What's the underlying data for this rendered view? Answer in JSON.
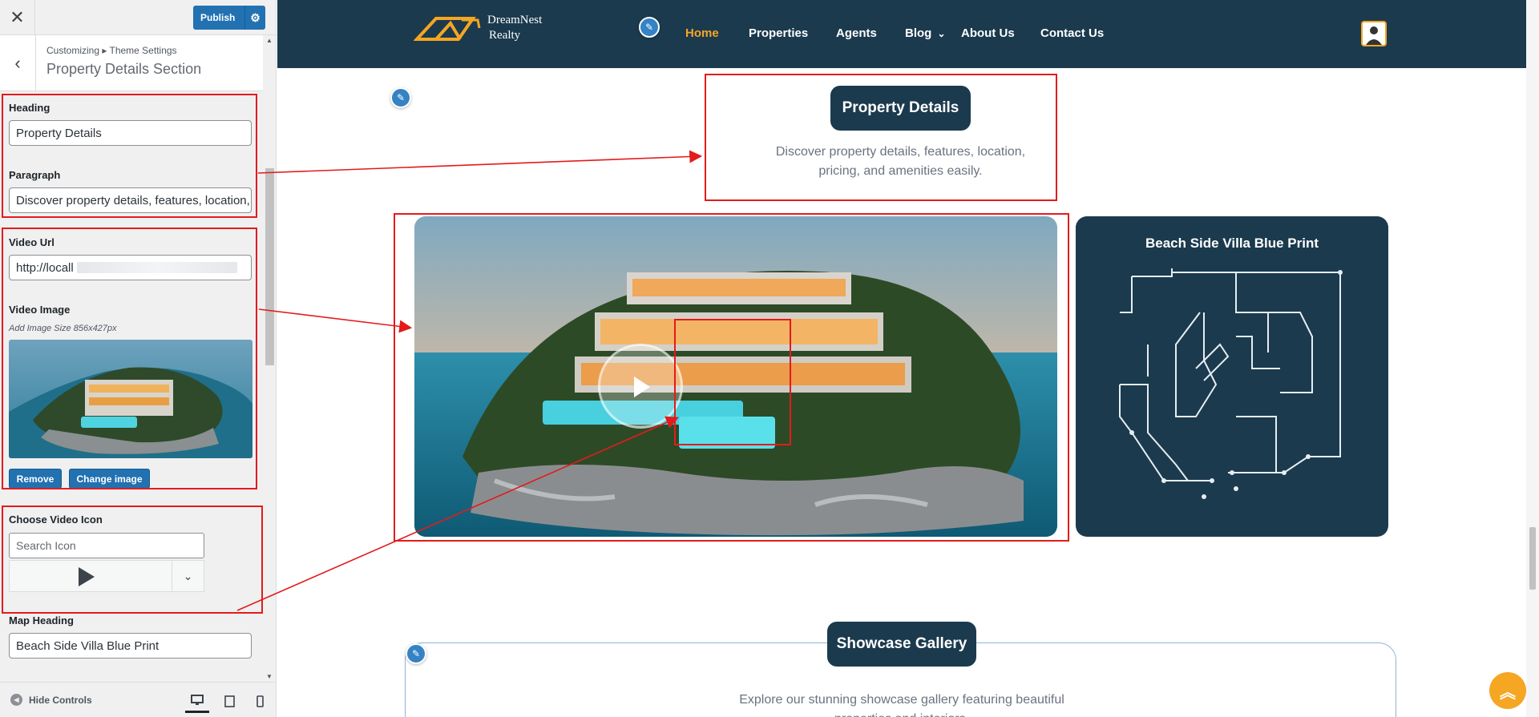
{
  "customizer": {
    "close_icon": "close-icon",
    "publish_label": "Publish",
    "breadcrumb": "Customizing ▸ Theme Settings",
    "section_title": "Property Details Section",
    "heading_label": "Heading",
    "heading_value": "Property Details",
    "paragraph_label": "Paragraph",
    "paragraph_value": "Discover property details, features, location, pricing, and amenities easily.",
    "video_url_label": "Video Url",
    "video_url_value": "http://locall",
    "video_image_label": "Video Image",
    "video_image_hint": "Add Image Size 856x427px",
    "remove_label": "Remove",
    "change_image_label": "Change image",
    "choose_icon_label": "Choose Video Icon",
    "icon_search_placeholder": "Search Icon",
    "map_heading_label": "Map Heading",
    "map_heading_value": "Beach Side Villa Blue Print",
    "hide_controls_label": "Hide Controls"
  },
  "site": {
    "logo_line1": "DreamNest",
    "logo_line2": "Realty",
    "menu": [
      "Home",
      "Properties",
      "Agents",
      "Blog",
      "About Us",
      "Contact Us"
    ],
    "active_menu": "Home",
    "property_heading": "Property Details",
    "property_paragraph": "Discover property details, features, location, pricing, and amenities easily.",
    "map_heading": "Beach Side Villa Blue Print",
    "gallery_heading": "Showcase Gallery",
    "gallery_paragraph": "Explore our stunning showcase gallery featuring beautiful properties and interiors."
  },
  "colors": {
    "nav_bg": "#1b3a4e",
    "accent": "#f5a623",
    "wp_blue": "#2271b1",
    "annotation_red": "#e31b1b"
  }
}
